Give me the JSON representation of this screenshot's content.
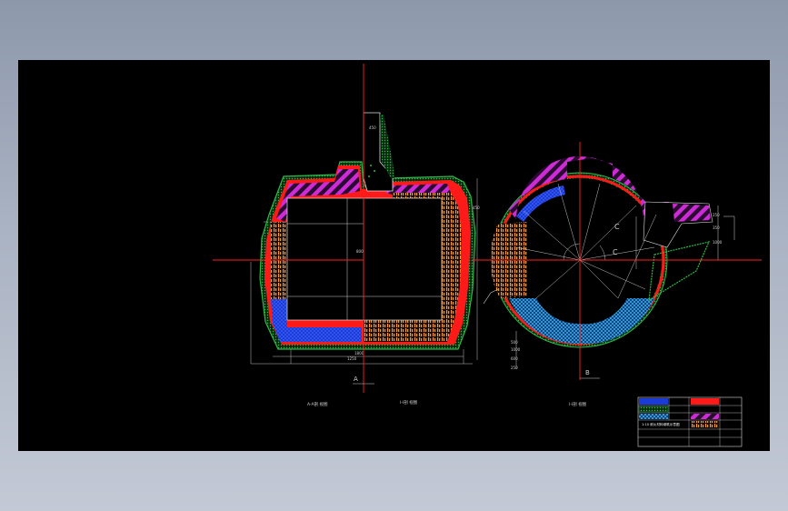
{
  "colors": {
    "background": "#000000",
    "page": "#9aa4b5",
    "blue_fill": "#1b3bd8",
    "red_lining": "#ff1a1a",
    "magenta_hatch": "#cc2bd6",
    "orange_hatch": "#ff9a3a",
    "green_border": "#2fb84a",
    "cyan_hatch": "#39c8d8"
  },
  "drawing": {
    "section_marks": {
      "a": "A",
      "b": "B"
    },
    "view_labels": {
      "left": "A-A剖 视图",
      "middle": "I-I剖 视图",
      "right": "I-I剖 视图"
    },
    "arc_labels": {
      "c1": "C",
      "c2": "C"
    }
  },
  "title_block": {
    "legend_note": "1:10 耐火材料砌筑示意图"
  }
}
